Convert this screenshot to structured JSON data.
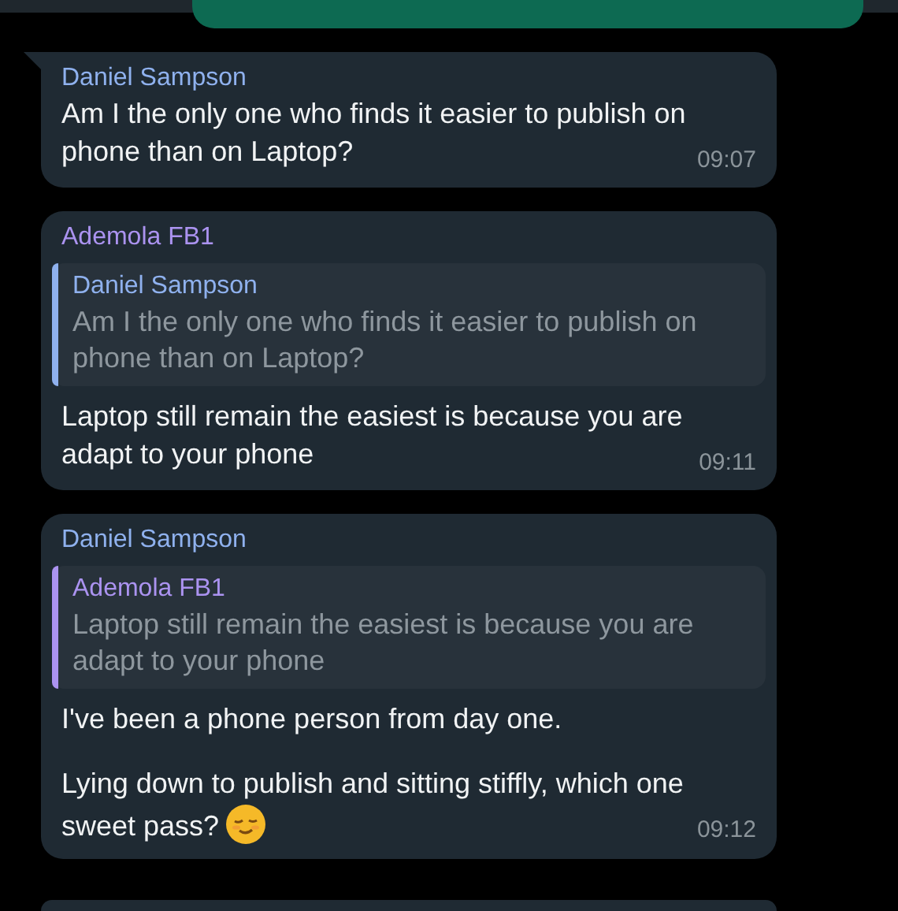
{
  "messages": [
    {
      "sender": "Daniel Sampson",
      "color": "#8fb1ee",
      "tail": true,
      "text": "Am I the only one who finds it easier to publish on phone than on Laptop?",
      "time": "09:07"
    },
    {
      "sender": "Ademola FB1",
      "color": "#ab93f0",
      "tail": false,
      "reply": {
        "sender": "Daniel Sampson",
        "color": "#8fb1ee",
        "text": "Am I the only one who finds it easier to publish on phone than on Laptop?"
      },
      "text": "Laptop still remain the easiest is because you are adapt to your phone",
      "time": "09:11"
    },
    {
      "sender": "Daniel Sampson",
      "color": "#8fb1ee",
      "tail": false,
      "reply": {
        "sender": "Ademola FB1",
        "color": "#ab93f0",
        "text": "Laptop still remain the easiest is because you are adapt to your phone"
      },
      "paragraphs": [
        "I've been a phone person from day one.",
        "Lying down to publish and sitting stiffly, which one sweet pass?"
      ],
      "emoji": true,
      "time": "09:12"
    }
  ]
}
